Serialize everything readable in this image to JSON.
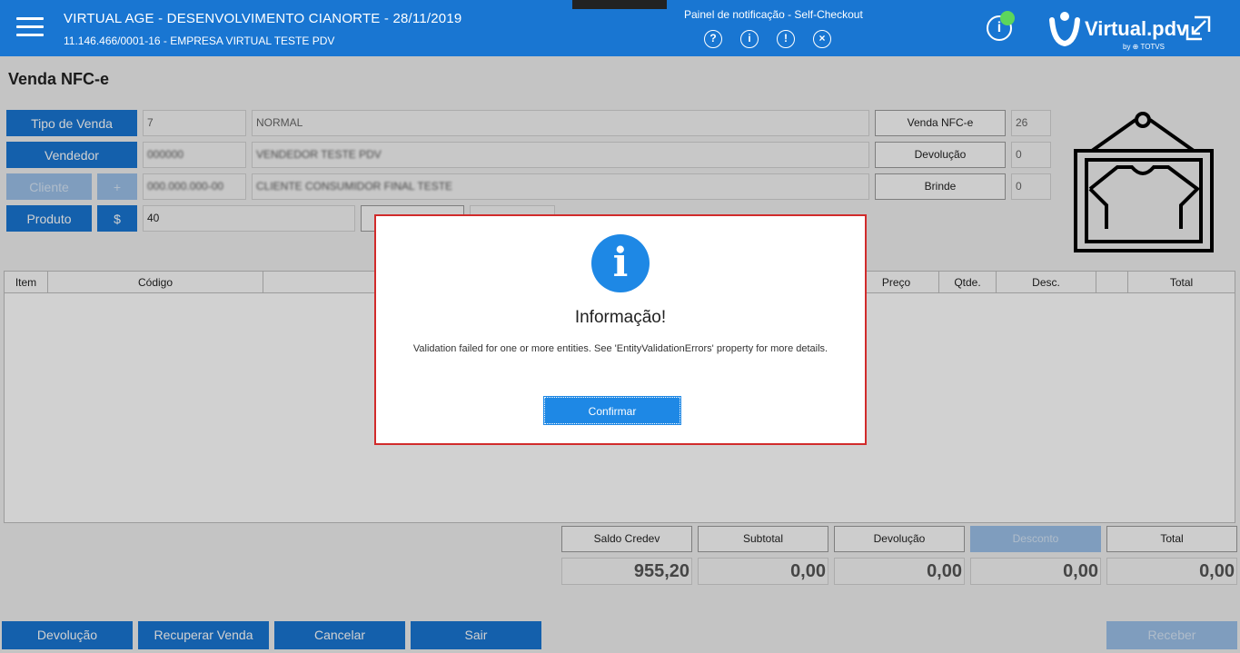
{
  "header": {
    "title": "VIRTUAL AGE - DESENVOLVIMENTO CIANORTE - 28/11/2019",
    "subtitle": "11.146.466/0001-16 - EMPRESA VIRTUAL TESTE PDV",
    "notification_label": "Painel de notificação - Self-Checkout",
    "notif_icons": [
      "?",
      "i",
      "!",
      "×"
    ],
    "info_icon": "i",
    "brand": "Virtual.pdv",
    "brand_by": "by ⊕ TOTVS"
  },
  "page": {
    "title": "Venda NFC-e"
  },
  "form": {
    "tipo_venda_label": "Tipo de Venda",
    "tipo_venda_code": "7",
    "tipo_venda_desc": "NORMAL",
    "vendedor_label": "Vendedor",
    "vendedor_code": "000000",
    "vendedor_name": "VENDEDOR TESTE PDV",
    "cliente_label": "Cliente",
    "cliente_add": "+",
    "cliente_code": "000.000.000-00",
    "cliente_name": "CLIENTE CONSUMIDOR FINAL TESTE",
    "produto_label": "Produto",
    "preco_btn": "$",
    "produto_value": "40"
  },
  "counters": [
    {
      "label": "Venda NFC-e",
      "value": "26"
    },
    {
      "label": "Devolução",
      "value": "0"
    },
    {
      "label": "Brinde",
      "value": "0"
    }
  ],
  "table": {
    "columns": [
      "Item",
      "Código",
      "Preço",
      "Qtde.",
      "Desc.",
      "",
      "Total"
    ]
  },
  "totals": [
    {
      "label": "Saldo Credev",
      "value": "955,20",
      "disabled": false
    },
    {
      "label": "Subtotal",
      "value": "0,00",
      "disabled": false
    },
    {
      "label": "Devolução",
      "value": "0,00",
      "disabled": false
    },
    {
      "label": "Desconto",
      "value": "0,00",
      "disabled": true
    },
    {
      "label": "Total",
      "value": "0,00",
      "disabled": false
    }
  ],
  "bottom_buttons": {
    "devolucao": "Devolução",
    "recuperar": "Recuperar Venda",
    "cancelar": "Cancelar",
    "sair": "Sair",
    "receber": "Receber"
  },
  "dialog": {
    "icon": "i",
    "title": "Informação!",
    "message": "Validation failed for one or more entities. See 'EntityValidationErrors' property for more details.",
    "confirm": "Confirmar"
  },
  "colors": {
    "primary": "#1976d2",
    "dialog_border": "#d12b2b",
    "online": "#5cd65c"
  }
}
